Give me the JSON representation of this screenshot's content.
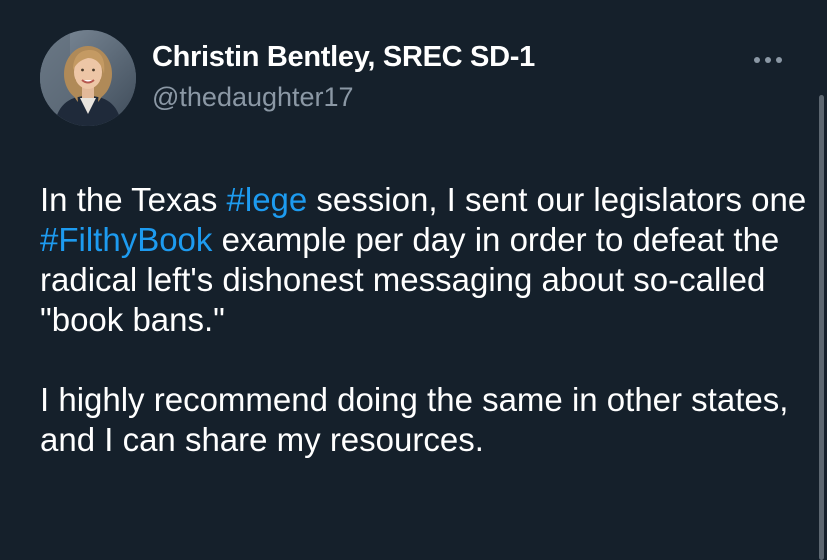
{
  "user": {
    "display_name": "Christin Bentley, SREC SD-1",
    "handle": "@thedaughter17"
  },
  "more_icon": "more-horizontal-icon",
  "tweet": {
    "paragraph_1": {
      "t1": "In the Texas ",
      "hashtag_1": "#lege",
      "t2": " session, I sent our legislators one ",
      "hashtag_2": "#FilthyBook",
      "t3": " example per day in order to defeat the radical left's dishonest messaging about so-called \"book bans.\""
    },
    "paragraph_2": "I highly recommend doing the same in other states, and I can share my resources."
  },
  "colors": {
    "background": "#15202b",
    "text": "#ffffff",
    "secondary_text": "#8b98a5",
    "link": "#1d9bf0"
  }
}
